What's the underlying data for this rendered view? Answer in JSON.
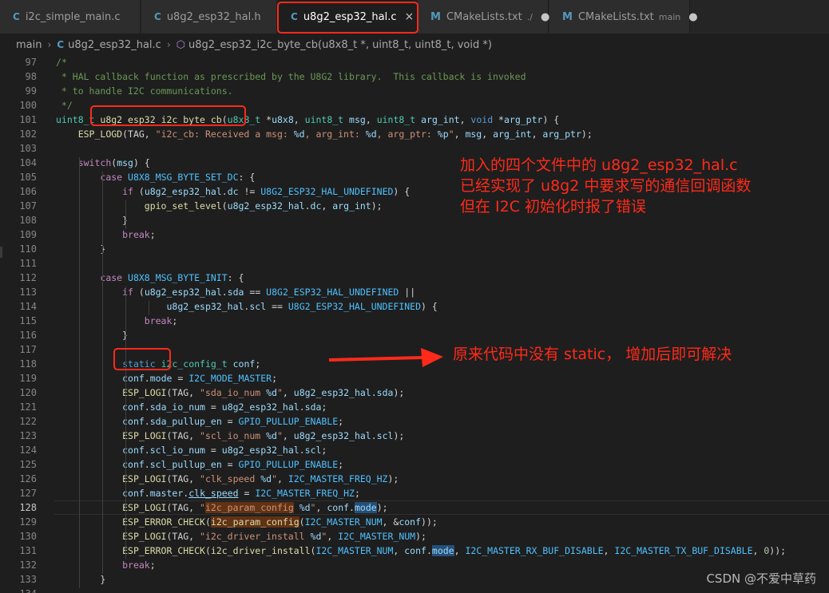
{
  "tabs": [
    {
      "label": "i2c_simple_main.c",
      "icon": "c-file-icon",
      "hint": "",
      "modified": false,
      "active": false
    },
    {
      "label": "u8g2_esp32_hal.h",
      "icon": "c-file-icon",
      "hint": "",
      "modified": false,
      "active": false
    },
    {
      "label": "u8g2_esp32_hal.c",
      "icon": "c-file-icon",
      "hint": "",
      "modified": false,
      "active": true
    },
    {
      "label": "CMakeLists.txt",
      "icon": "cmake-file-icon",
      "hint": "./",
      "modified": true,
      "active": false
    },
    {
      "label": "CMakeLists.txt",
      "icon": "cmake-file-icon",
      "hint": "main",
      "modified": true,
      "active": false
    }
  ],
  "icon_glyphs": {
    "c": "C",
    "m": "M",
    "close": "×",
    "dot": "●",
    "chevron": "›",
    "cube": "⬡"
  },
  "breadcrumb": {
    "folder": "main",
    "file": "u8g2_esp32_hal.c",
    "symbol": "u8g2_esp32_i2c_byte_cb(u8x8_t *, uint8_t, uint8_t, void *)"
  },
  "editor": {
    "current_line": 128,
    "lines": [
      {
        "n": "97",
        "html": "<span class=\"cm\">/*</span>"
      },
      {
        "n": "98",
        "html": "<span class=\"cm\"> * HAL callback function as prescribed by the U8G2 library.  This callback is invoked</span>"
      },
      {
        "n": "99",
        "html": "<span class=\"cm\"> * to handle I2C communications.</span>"
      },
      {
        "n": "100",
        "html": "<span class=\"cm\"> */</span>"
      },
      {
        "n": "101",
        "html": "<span class=\"t\">uint8_t</span> <span class=\"f\">u8g2_esp32_i2c_byte_cb</span>(<span class=\"t\">u8x8_t</span> *<span class=\"v\">u8x8</span>, <span class=\"t\">uint8_t</span> <span class=\"v\">msg</span>, <span class=\"t\">uint8_t</span> <span class=\"v\">arg_int</span>, <span class=\"k\">void</span> *<span class=\"v\">arg_ptr</span>) {"
      },
      {
        "n": "102",
        "html": "    <span class=\"f\">ESP_LOGD</span>(TAG, <span class=\"s\">\"i2c_cb: Received a msg: </span><span class=\"ph\">%d</span><span class=\"s\">, arg_int: </span><span class=\"ph\">%d</span><span class=\"s\">, arg_ptr: </span><span class=\"ph\">%p</span><span class=\"s\">\"</span>, <span class=\"v\">msg</span>, <span class=\"v\">arg_int</span>, <span class=\"v\">arg_ptr</span>);"
      },
      {
        "n": "103",
        "html": ""
      },
      {
        "n": "104",
        "html": "    <span class=\"kp\">switch</span>(<span class=\"v\">msg</span>) {"
      },
      {
        "n": "105",
        "html": "        <span class=\"kp\">case</span> <span class=\"m\">U8X8_MSG_BYTE_SET_DC</span>: {"
      },
      {
        "n": "106",
        "html": "            <span class=\"kp\">if</span> (<span class=\"v\">u8g2_esp32_hal</span>.<span class=\"v\">dc</span> != <span class=\"m\">U8G2_ESP32_HAL_UNDEFINED</span>) {"
      },
      {
        "n": "107",
        "html": "                <span class=\"f\">gpio_set_level</span>(<span class=\"v\">u8g2_esp32_hal</span>.<span class=\"v\">dc</span>, <span class=\"v\">arg_int</span>);"
      },
      {
        "n": "108",
        "html": "            }"
      },
      {
        "n": "109",
        "html": "            <span class=\"kp\">break</span>;"
      },
      {
        "n": "110",
        "html": "        }"
      },
      {
        "n": "111",
        "html": ""
      },
      {
        "n": "112",
        "html": "        <span class=\"kp\">case</span> <span class=\"m\">U8X8_MSG_BYTE_INIT</span>: {"
      },
      {
        "n": "113",
        "html": "            <span class=\"kp\">if</span> (<span class=\"v\">u8g2_esp32_hal</span>.<span class=\"v\">sda</span> == <span class=\"m\">U8G2_ESP32_HAL_UNDEFINED</span> ||"
      },
      {
        "n": "114",
        "html": "                    <span class=\"v\">u8g2_esp32_hal</span>.<span class=\"v\">scl</span> == <span class=\"m\">U8G2_ESP32_HAL_UNDEFINED</span>) {"
      },
      {
        "n": "115",
        "html": "                <span class=\"kp\">break</span>;"
      },
      {
        "n": "116",
        "html": "            }"
      },
      {
        "n": "117",
        "html": ""
      },
      {
        "n": "118",
        "html": "            <span class=\"k\">static</span> <span class=\"t\">i2c_config_t</span> <span class=\"v\">conf</span>;"
      },
      {
        "n": "119",
        "html": "            <span class=\"v\">conf</span>.<span class=\"v\">mode</span> = <span class=\"m\">I2C_MODE_MASTER</span>;"
      },
      {
        "n": "120",
        "html": "            <span class=\"f\">ESP_LOGI</span>(TAG, <span class=\"s\">\"sda_io_num </span><span class=\"ph\">%d</span><span class=\"s\">\"</span>, <span class=\"v\">u8g2_esp32_hal</span>.<span class=\"v\">sda</span>);"
      },
      {
        "n": "121",
        "html": "            <span class=\"v\">conf</span>.<span class=\"v\">sda_io_num</span> = <span class=\"v\">u8g2_esp32_hal</span>.<span class=\"v\">sda</span>;"
      },
      {
        "n": "122",
        "html": "            <span class=\"v\">conf</span>.<span class=\"v\">sda_pullup_en</span> = <span class=\"m\">GPIO_PULLUP_ENABLE</span>;"
      },
      {
        "n": "123",
        "html": "            <span class=\"f\">ESP_LOGI</span>(TAG, <span class=\"s\">\"scl_io_num </span><span class=\"ph\">%d</span><span class=\"s\">\"</span>, <span class=\"v\">u8g2_esp32_hal</span>.<span class=\"v\">scl</span>);"
      },
      {
        "n": "124",
        "html": "            <span class=\"v\">conf</span>.<span class=\"v\">scl_io_num</span> = <span class=\"v\">u8g2_esp32_hal</span>.<span class=\"v\">scl</span>;"
      },
      {
        "n": "125",
        "html": "            <span class=\"v\">conf</span>.<span class=\"v\">scl_pullup_en</span> = <span class=\"m\">GPIO_PULLUP_ENABLE</span>;"
      },
      {
        "n": "126",
        "html": "            <span class=\"f\">ESP_LOGI</span>(TAG, <span class=\"s\">\"clk_speed </span><span class=\"ph\">%d</span><span class=\"s\">\"</span>, <span class=\"m\">I2C_MASTER_FREQ_HZ</span>);"
      },
      {
        "n": "127",
        "html": "            <span class=\"v\">conf</span>.<span class=\"v\">master</span>.<span class=\"v ul\">clk_speed</span> = <span class=\"m\">I2C_MASTER_FREQ_HZ</span>;"
      },
      {
        "n": "128",
        "html": "            <span class=\"f\">ESP_LOGI</span>(TAG, <span class=\"s\">\"<span class=\"hl\">i2c_param_config</span> </span><span class=\"ph\">%d</span><span class=\"s\">\"</span>, <span class=\"v\">conf</span>.<span class=\"v hl2\">mode</span>);"
      },
      {
        "n": "129",
        "html": "            <span class=\"f\">ESP_ERROR_CHECK</span>(<span class=\"f hl\">i2c_param_config</span>(<span class=\"m\">I2C_MASTER_NUM</span>, &amp;<span class=\"v\">conf</span>));"
      },
      {
        "n": "130",
        "html": "            <span class=\"f\">ESP_LOGI</span>(TAG, <span class=\"s\">\"i2c_driver_install </span><span class=\"ph\">%d</span><span class=\"s\">\"</span>, <span class=\"m\">I2C_MASTER_NUM</span>);"
      },
      {
        "n": "131",
        "html": "            <span class=\"f\">ESP_ERROR_CHECK</span>(<span class=\"f\">i2c_driver_install</span>(<span class=\"m\">I2C_MASTER_NUM</span>, <span class=\"v\">conf</span>.<span class=\"v hl2\">mode</span>, <span class=\"m\">I2C_MASTER_RX_BUF_DISABLE</span>, <span class=\"m\">I2C_MASTER_TX_BUF_DISABLE</span>, <span class=\"n\">0</span>));"
      },
      {
        "n": "132",
        "html": "            <span class=\"kp\">break</span>;"
      },
      {
        "n": "133",
        "html": "        }"
      },
      {
        "n": "134",
        "html": ""
      }
    ]
  },
  "annotations": {
    "note1_lines": [
      "加入的四个文件中的 u8g2_esp32_hal.c",
      "已经实现了 u8g2 中要求写的通信回调函数",
      "但在 I2C 初始化时报了错误"
    ],
    "note2": "原来代码中没有 static， 增加后即可解决"
  },
  "watermark": "CSDN @不爱中草药",
  "colors": {
    "annotation_red": "#ff2a1a",
    "editor_bg": "#1e1e1e",
    "tab_bg": "#2d2d2d"
  }
}
